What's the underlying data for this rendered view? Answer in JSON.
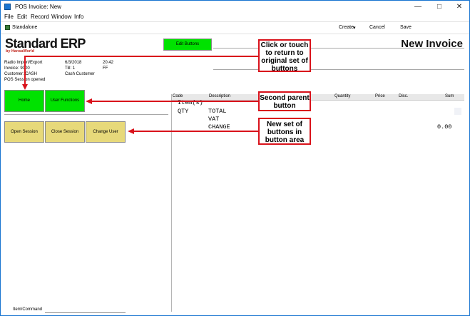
{
  "window": {
    "title": "POS Invoice: New"
  },
  "menu": [
    "File",
    "Edit",
    "Record",
    "Window",
    "Info"
  ],
  "toolbar": {
    "mode": "Standalone",
    "create": "Create",
    "cancel": "Cancel",
    "save": "Save"
  },
  "logo": {
    "main": "Standard ERP",
    "sub": "by HansaWorld"
  },
  "edit_buttons_label": "Edit Buttons",
  "form_title": "New Invoice",
  "info": {
    "company": "Radio Import/Export",
    "date": "6/3/2018",
    "time": "20:42",
    "invoice_label": "Invoice: 9000",
    "till_label": "Till: 1",
    "till_code": "FF",
    "customer_label": "Customer: CASH",
    "customer_name": "Cash Customer",
    "session": "POS Session opened"
  },
  "parent_buttons": [
    "Home",
    "User Functions"
  ],
  "area_buttons": [
    "Open Session",
    "Close Session",
    "Change User"
  ],
  "table": {
    "columns": [
      "Code",
      "Description",
      "Quantity",
      "Price",
      "Disc.",
      "Sum"
    ]
  },
  "receipt": {
    "items": "Item(s)",
    "qty": "QTY",
    "total": "TOTAL",
    "vat": "VAT",
    "change": "CHANGE",
    "change_value": "0.00"
  },
  "command_label": "Item/Command",
  "annotations": {
    "a1": "Click or touch to return to original set of buttons",
    "a2": "Second parent button",
    "a3": "New set of buttons in button area"
  },
  "colors": {
    "button_green": "#00e200",
    "button_yellow": "#e7d97a",
    "annotation_red": "#d9121b"
  }
}
